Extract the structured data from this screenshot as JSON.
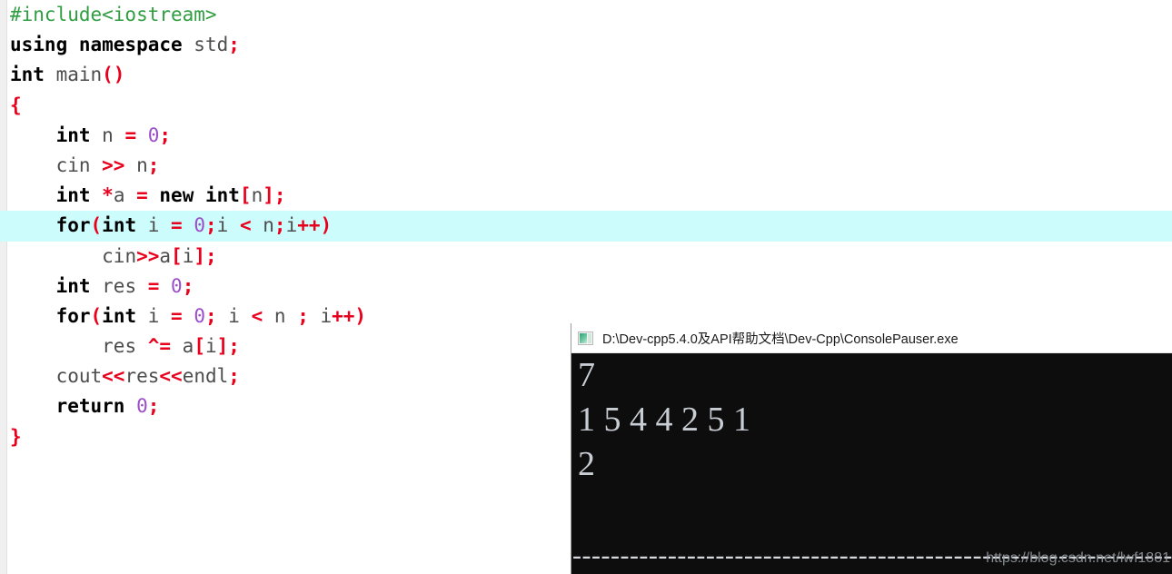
{
  "editor": {
    "background": "#ffffff",
    "gutter_color": "#f0f0f0",
    "highlight_color": "#ccfcfc",
    "highlighted_line_index": 8,
    "colors": {
      "preprocessor": "#2f9e41",
      "keyword": "#000000",
      "identifier": "#4d4d4d",
      "operator": "#e8001c",
      "number": "#9b4dca"
    },
    "lines": [
      {
        "indent": 0,
        "tokens": [
          {
            "t": "pre",
            "v": "#include<iostream>"
          }
        ]
      },
      {
        "indent": 0,
        "tokens": [
          {
            "t": "kw",
            "v": "using namespace"
          },
          {
            "t": "id",
            "v": " std"
          },
          {
            "t": "op",
            "v": ";"
          }
        ]
      },
      {
        "indent": 0,
        "tokens": [
          {
            "t": "kw",
            "v": "int"
          },
          {
            "t": "id",
            "v": " main"
          },
          {
            "t": "op",
            "v": "()"
          }
        ]
      },
      {
        "indent": 0,
        "tokens": [
          {
            "t": "brace",
            "v": "{"
          }
        ]
      },
      {
        "indent": 4,
        "tokens": [
          {
            "t": "kw",
            "v": "int"
          },
          {
            "t": "id",
            "v": " n "
          },
          {
            "t": "op",
            "v": "="
          },
          {
            "t": "num",
            "v": " 0"
          },
          {
            "t": "op",
            "v": ";"
          }
        ]
      },
      {
        "indent": 4,
        "tokens": [
          {
            "t": "id",
            "v": "cin "
          },
          {
            "t": "op",
            "v": ">>"
          },
          {
            "t": "id",
            "v": " n"
          },
          {
            "t": "op",
            "v": ";"
          }
        ]
      },
      {
        "indent": 4,
        "tokens": [
          {
            "t": "kw",
            "v": "int "
          },
          {
            "t": "op",
            "v": "*"
          },
          {
            "t": "id",
            "v": "a "
          },
          {
            "t": "op",
            "v": "="
          },
          {
            "t": "kw",
            "v": " new int"
          },
          {
            "t": "op",
            "v": "["
          },
          {
            "t": "id",
            "v": "n"
          },
          {
            "t": "op",
            "v": "];"
          }
        ]
      },
      {
        "indent": 4,
        "tokens": [
          {
            "t": "kw",
            "v": "for"
          },
          {
            "t": "op",
            "v": "("
          },
          {
            "t": "kw",
            "v": "int"
          },
          {
            "t": "id",
            "v": " i "
          },
          {
            "t": "op",
            "v": "="
          },
          {
            "t": "num",
            "v": " 0"
          },
          {
            "t": "op",
            "v": ";"
          },
          {
            "t": "id",
            "v": "i "
          },
          {
            "t": "op",
            "v": "<"
          },
          {
            "t": "id",
            "v": " n"
          },
          {
            "t": "op",
            "v": ";"
          },
          {
            "t": "id",
            "v": "i"
          },
          {
            "t": "op",
            "v": "++)"
          }
        ],
        "highlight": true
      },
      {
        "indent": 8,
        "tokens": [
          {
            "t": "id",
            "v": "cin"
          },
          {
            "t": "op",
            "v": ">>"
          },
          {
            "t": "id",
            "v": "a"
          },
          {
            "t": "op",
            "v": "["
          },
          {
            "t": "id",
            "v": "i"
          },
          {
            "t": "op",
            "v": "];"
          }
        ]
      },
      {
        "indent": 4,
        "tokens": [
          {
            "t": "kw",
            "v": "int"
          },
          {
            "t": "id",
            "v": " res "
          },
          {
            "t": "op",
            "v": "="
          },
          {
            "t": "num",
            "v": " 0"
          },
          {
            "t": "op",
            "v": ";"
          }
        ]
      },
      {
        "indent": 4,
        "tokens": [
          {
            "t": "kw",
            "v": "for"
          },
          {
            "t": "op",
            "v": "("
          },
          {
            "t": "kw",
            "v": "int"
          },
          {
            "t": "id",
            "v": " i "
          },
          {
            "t": "op",
            "v": "="
          },
          {
            "t": "num",
            "v": " 0"
          },
          {
            "t": "op",
            "v": ";"
          },
          {
            "t": "id",
            "v": " i "
          },
          {
            "t": "op",
            "v": "<"
          },
          {
            "t": "id",
            "v": " n "
          },
          {
            "t": "op",
            "v": ";"
          },
          {
            "t": "id",
            "v": " i"
          },
          {
            "t": "op",
            "v": "++)"
          }
        ]
      },
      {
        "indent": 8,
        "tokens": [
          {
            "t": "id",
            "v": "res "
          },
          {
            "t": "op",
            "v": "^="
          },
          {
            "t": "id",
            "v": " a"
          },
          {
            "t": "op",
            "v": "["
          },
          {
            "t": "id",
            "v": "i"
          },
          {
            "t": "op",
            "v": "];"
          }
        ]
      },
      {
        "indent": 4,
        "tokens": [
          {
            "t": "id",
            "v": "cout"
          },
          {
            "t": "op",
            "v": "<<"
          },
          {
            "t": "id",
            "v": "res"
          },
          {
            "t": "op",
            "v": "<<"
          },
          {
            "t": "id",
            "v": "endl"
          },
          {
            "t": "op",
            "v": ";"
          }
        ]
      },
      {
        "indent": 4,
        "tokens": [
          {
            "t": "kw",
            "v": "return"
          },
          {
            "t": "num",
            "v": " 0"
          },
          {
            "t": "op",
            "v": ";"
          }
        ]
      },
      {
        "indent": 0,
        "tokens": [
          {
            "t": "brace",
            "v": "}"
          }
        ]
      }
    ],
    "plain_text": "#include<iostream>\nusing namespace std;\nint main()\n{\n    int n = 0;\n    cin >> n;\n    int *a = new int[n];\n    for(int i = 0;i < n;i++)\n        cin>>a[i];\n    int res = 0;\n    for(int i = 0; i < n ; i++)\n        res ^= a[i];\n    cout<<res<<endl;\n    return 0;\n}"
  },
  "console": {
    "title": "D:\\Dev-cpp5.4.0及API帮助文档\\Dev-Cpp\\ConsolePauser.exe",
    "icon": "console-window-icon",
    "background": "#0d0d0d",
    "text_color": "#c8cdd4",
    "output_lines": [
      "7",
      "1 5 4 4 2 5 1",
      "2"
    ],
    "separator": "--------------------------------",
    "input_n": 7,
    "input_array": [
      1,
      5,
      4,
      4,
      2,
      5,
      1
    ],
    "result": 2
  },
  "watermark": {
    "text": "https://blog.csdn.net/lwf1881"
  }
}
